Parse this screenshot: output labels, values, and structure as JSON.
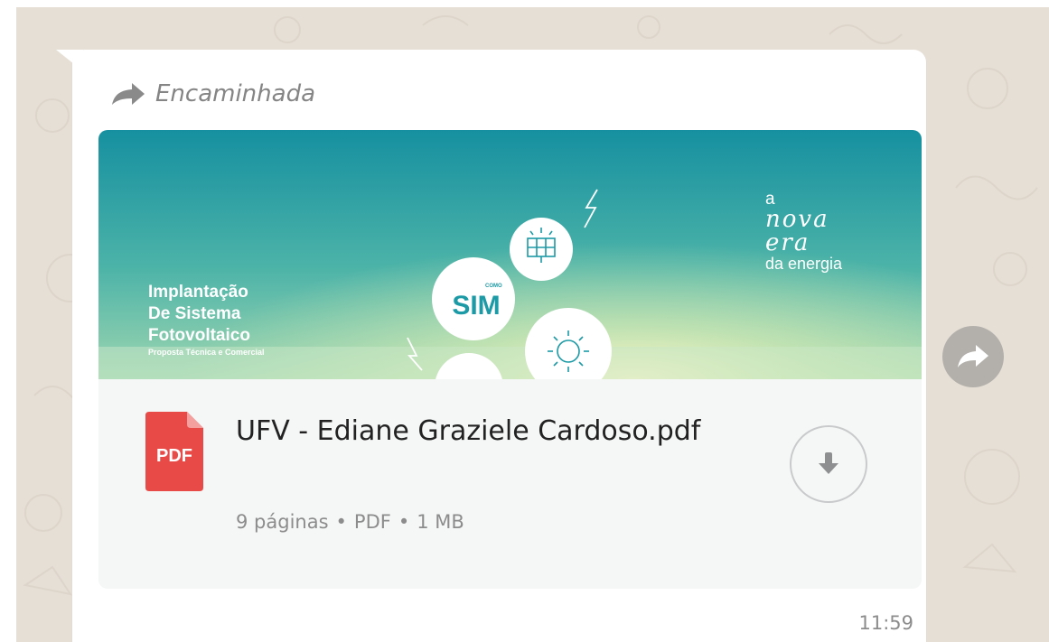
{
  "message": {
    "forwarded_label": "Encaminhada",
    "timestamp": "11:59",
    "document": {
      "file_name": "UFV - Ediane Graziele Cardoso.pdf",
      "meta": {
        "pages": "9 páginas",
        "type": "PDF",
        "size": "1 MB",
        "separator": "•"
      },
      "icon_label": "PDF",
      "preview": {
        "title_lines": [
          "Implantação",
          "De Sistema",
          "Fotovoltaico"
        ],
        "subtitle": "Proposta Técnica e Comercial",
        "brand_small": "COMO",
        "brand": "SIM",
        "slogan_a": "a",
        "slogan_nova": "nova",
        "slogan_era": "era",
        "slogan_energia": "da energia"
      }
    }
  },
  "icons": {
    "forwarded": "forward-arrow-icon",
    "download": "download-arrow-icon",
    "share": "forward-share-icon",
    "file": "pdf-file-icon"
  },
  "colors": {
    "chat_background": "#e6dfd6",
    "bubble": "#ffffff",
    "doc_card": "#f5f6f6",
    "pdf_red": "#e84a47",
    "preview_teal": "#1b9aa7",
    "muted_text": "#8c8c8c"
  }
}
